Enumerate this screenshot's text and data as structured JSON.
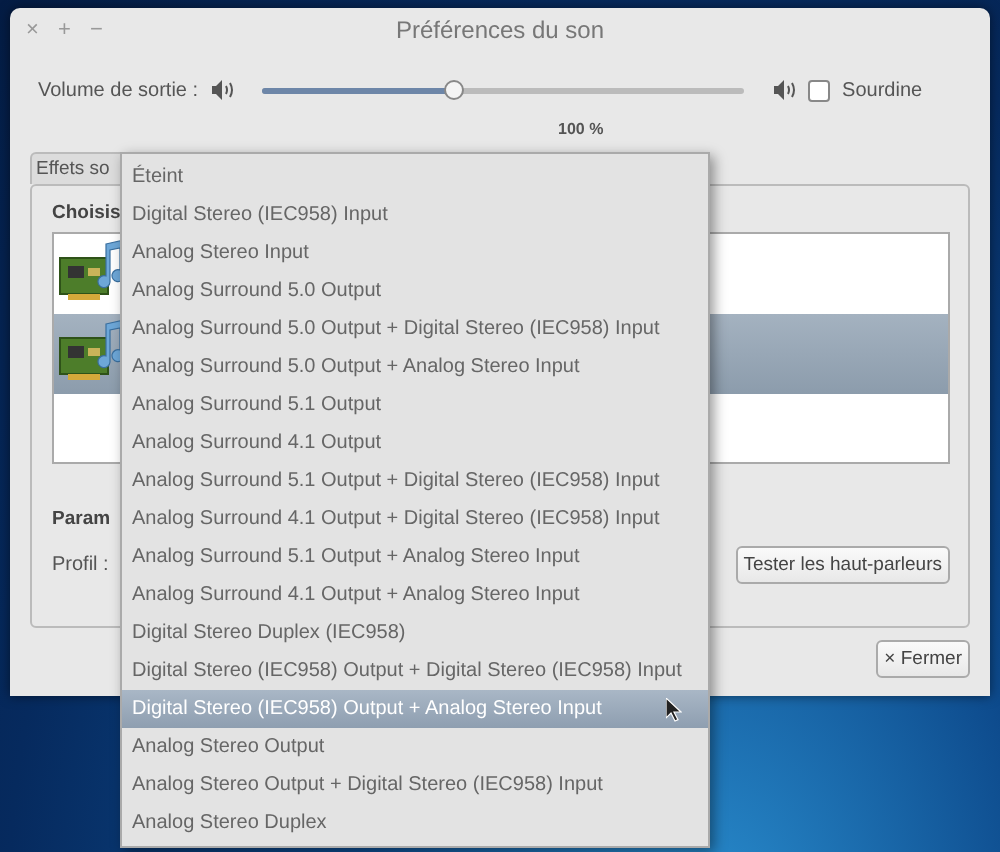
{
  "window": {
    "title": "Préférences du son",
    "controls": [
      "×",
      "+",
      "−"
    ]
  },
  "volume": {
    "label": "Volume de sortie :",
    "level": 0.4,
    "mark": "100 %",
    "mute": {
      "label": "Sourdine",
      "checked": false
    }
  },
  "tabs": [
    {
      "label": "Effets so",
      "selected": false
    }
  ],
  "section_1": {
    "label": "Choisis"
  },
  "devices": [
    {
      "selected": false
    },
    {
      "selected": true
    }
  ],
  "section_2": {
    "label": "Param"
  },
  "profile": {
    "label": "Profil :"
  },
  "test_button": "Tester les haut-parleurs",
  "close_button": {
    "icon": "×",
    "label": "Fermer"
  },
  "menu": [
    {
      "label": "Éteint",
      "selected": false
    },
    {
      "label": "Digital Stereo (IEC958) Input",
      "selected": false
    },
    {
      "label": "Analog Stereo Input",
      "selected": false
    },
    {
      "label": "Analog Surround 5.0 Output",
      "selected": false
    },
    {
      "label": "Analog Surround 5.0 Output + Digital Stereo (IEC958) Input",
      "selected": false
    },
    {
      "label": "Analog Surround 5.0 Output + Analog Stereo Input",
      "selected": false
    },
    {
      "label": "Analog Surround 5.1 Output",
      "selected": false
    },
    {
      "label": "Analog Surround 4.1 Output",
      "selected": false
    },
    {
      "label": "Analog Surround 5.1 Output + Digital Stereo (IEC958) Input",
      "selected": false
    },
    {
      "label": "Analog Surround 4.1 Output + Digital Stereo (IEC958) Input",
      "selected": false
    },
    {
      "label": "Analog Surround 5.1 Output + Analog Stereo Input",
      "selected": false
    },
    {
      "label": "Analog Surround 4.1 Output + Analog Stereo Input",
      "selected": false
    },
    {
      "label": "Digital Stereo Duplex (IEC958)",
      "selected": false
    },
    {
      "label": "Digital Stereo (IEC958) Output + Digital Stereo (IEC958) Input",
      "selected": false
    },
    {
      "label": "Digital Stereo (IEC958) Output + Analog Stereo Input",
      "selected": true
    },
    {
      "label": "Analog Stereo Output",
      "selected": false
    },
    {
      "label": "Analog Stereo Output + Digital Stereo (IEC958) Input",
      "selected": false
    },
    {
      "label": "Analog Stereo Duplex",
      "selected": false
    }
  ]
}
